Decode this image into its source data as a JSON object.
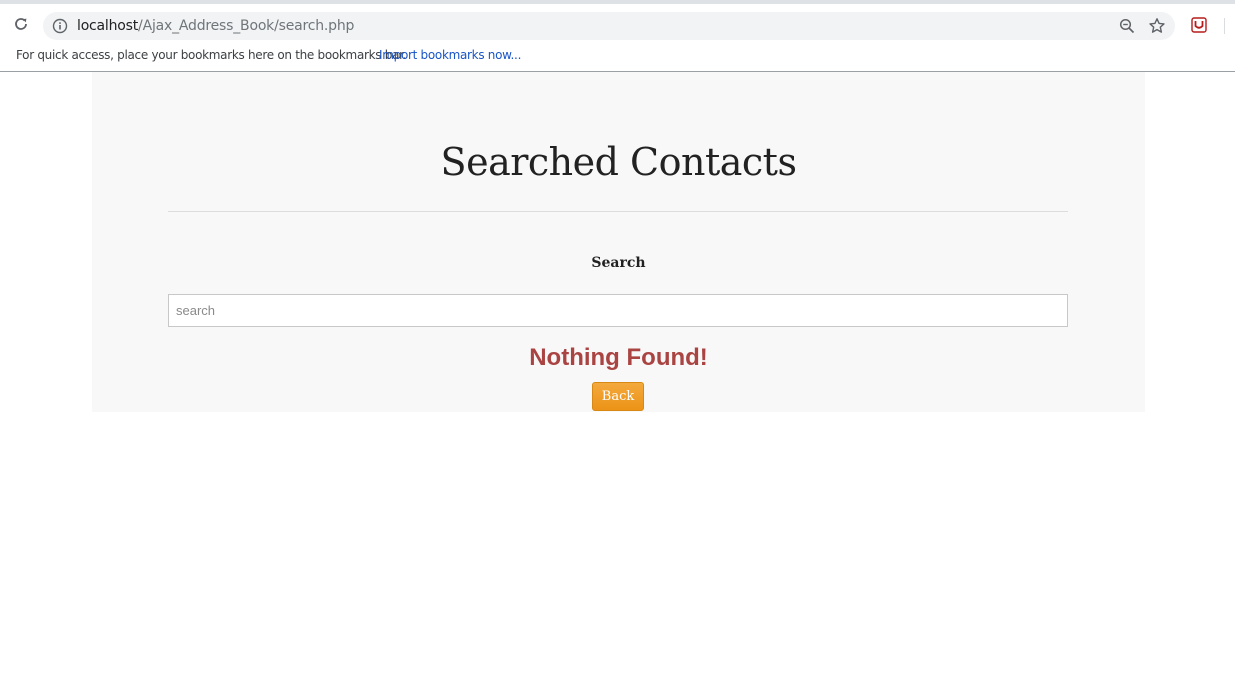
{
  "browser": {
    "url_host": "localhost",
    "url_path": "/Ajax_Address_Book/search.php",
    "bookmarks_bar_text": "For quick access, place your bookmarks here on the bookmarks bar.",
    "bookmarks_bar_link": "Import bookmarks now..."
  },
  "page": {
    "title": "Searched Contacts",
    "search_label": "Search",
    "search_placeholder": "search",
    "search_value": "",
    "message": "Nothing Found!",
    "back_button_label": "Back"
  },
  "colors": {
    "message": "#a94442",
    "back_button": "#ec9317",
    "container_bg": "#f8f8f8",
    "link": "#1a55c7"
  }
}
